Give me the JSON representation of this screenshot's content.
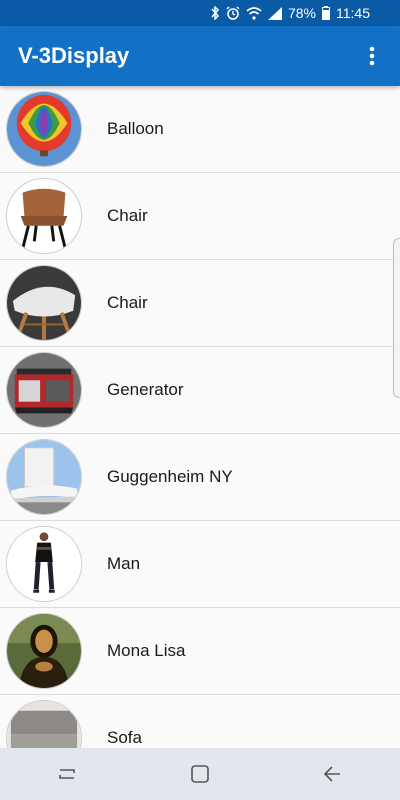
{
  "status_bar": {
    "battery": "78%",
    "time": "11:45",
    "icons": [
      "bluetooth-icon",
      "alarm-icon",
      "wifi-icon",
      "signal-icon",
      "battery-icon"
    ]
  },
  "app_bar": {
    "title": "V-3Display",
    "menu_icon": "more-vert-icon",
    "color": "#1271c4"
  },
  "models": [
    {
      "label": "Balloon",
      "thumb": "balloon"
    },
    {
      "label": "Chair",
      "thumb": "chair-leather"
    },
    {
      "label": "Chair",
      "thumb": "chair-white"
    },
    {
      "label": "Generator",
      "thumb": "generator"
    },
    {
      "label": "Guggenheim NY",
      "thumb": "guggenheim"
    },
    {
      "label": "Man",
      "thumb": "man"
    },
    {
      "label": "Mona Lisa",
      "thumb": "mona-lisa"
    },
    {
      "label": "Sofa",
      "thumb": "sofa"
    }
  ],
  "nav_bar": {
    "buttons": [
      "recent-apps-icon",
      "home-icon",
      "back-icon"
    ]
  }
}
